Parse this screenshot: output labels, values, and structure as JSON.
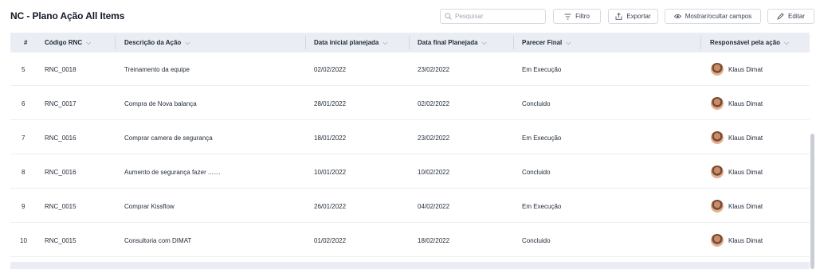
{
  "page": {
    "title": "NC - Plano Ação All Items"
  },
  "toolbar": {
    "search_placeholder": "Pesquisar",
    "filtro_label": "Filtro",
    "exportar_label": "Exportar",
    "mostrar_label": "Mostrar/ocultar campos",
    "editar_label": "Editar"
  },
  "table": {
    "columns": {
      "num": "#",
      "codigo": "Código RNC",
      "descricao": "Descrição da Ação",
      "data_inicial": "Data inicial planejada",
      "data_final": "Data final Planejada",
      "parecer": "Parecer Final",
      "responsavel": "Responsável pela ação"
    },
    "rows": [
      {
        "num": "5",
        "codigo": "RNC_0018",
        "descricao": "Treinamento da equipe",
        "data_inicial": "02/02/2022",
        "data_final": "23/02/2022",
        "parecer": "Em Execução",
        "responsavel": "Klaus Dimat"
      },
      {
        "num": "6",
        "codigo": "RNC_0017",
        "descricao": "Compra de Nova balança",
        "data_inicial": "28/01/2022",
        "data_final": "02/02/2022",
        "parecer": "Concluido",
        "responsavel": "Klaus Dimat"
      },
      {
        "num": "7",
        "codigo": "RNC_0016",
        "descricao": "Comprar camera de segurança",
        "data_inicial": "18/01/2022",
        "data_final": "23/02/2022",
        "parecer": "Em Execução",
        "responsavel": "Klaus Dimat"
      },
      {
        "num": "8",
        "codigo": "RNC_0016",
        "descricao": "Aumento de segurança fazer .......",
        "data_inicial": "10/01/2022",
        "data_final": "10/02/2022",
        "parecer": "Concluido",
        "responsavel": "Klaus Dimat"
      },
      {
        "num": "9",
        "codigo": "RNC_0015",
        "descricao": "Comprar Kissflow",
        "data_inicial": "26/01/2022",
        "data_final": "04/02/2022",
        "parecer": "Em Execução",
        "responsavel": "Klaus Dimat"
      },
      {
        "num": "10",
        "codigo": "RNC_0015",
        "descricao": "Consultoria com DIMAT",
        "data_inicial": "01/02/2022",
        "data_final": "18/02/2022",
        "parecer": "Concluido",
        "responsavel": "Klaus Dimat"
      }
    ]
  },
  "icons": {
    "search": "search-icon",
    "filter": "filter-icon",
    "export": "export-icon",
    "eye": "eye-icon",
    "edit": "pencil-icon",
    "sort": "chevron-down-icon",
    "avatar": "user-avatar"
  },
  "colors": {
    "header_bg": "#eaeef4",
    "border": "#d6dae1",
    "text": "#1f2937"
  }
}
